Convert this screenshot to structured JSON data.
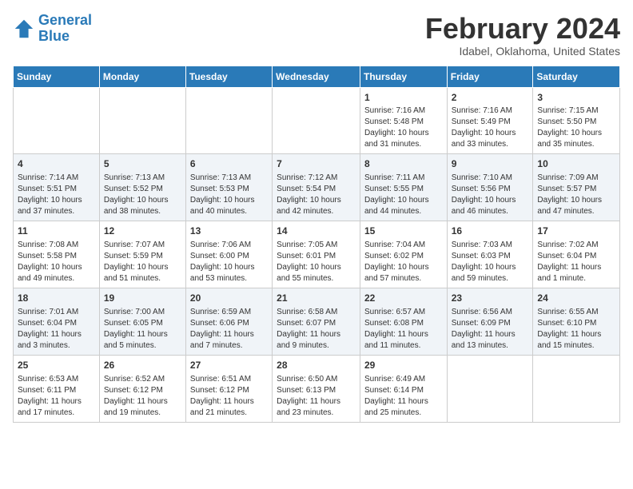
{
  "header": {
    "logo_line1": "General",
    "logo_line2": "Blue",
    "title": "February 2024",
    "subtitle": "Idabel, Oklahoma, United States"
  },
  "weekdays": [
    "Sunday",
    "Monday",
    "Tuesday",
    "Wednesday",
    "Thursday",
    "Friday",
    "Saturday"
  ],
  "weeks": [
    [
      {
        "day": "",
        "info": ""
      },
      {
        "day": "",
        "info": ""
      },
      {
        "day": "",
        "info": ""
      },
      {
        "day": "",
        "info": ""
      },
      {
        "day": "1",
        "info": "Sunrise: 7:16 AM\nSunset: 5:48 PM\nDaylight: 10 hours and 31 minutes."
      },
      {
        "day": "2",
        "info": "Sunrise: 7:16 AM\nSunset: 5:49 PM\nDaylight: 10 hours and 33 minutes."
      },
      {
        "day": "3",
        "info": "Sunrise: 7:15 AM\nSunset: 5:50 PM\nDaylight: 10 hours and 35 minutes."
      }
    ],
    [
      {
        "day": "4",
        "info": "Sunrise: 7:14 AM\nSunset: 5:51 PM\nDaylight: 10 hours and 37 minutes."
      },
      {
        "day": "5",
        "info": "Sunrise: 7:13 AM\nSunset: 5:52 PM\nDaylight: 10 hours and 38 minutes."
      },
      {
        "day": "6",
        "info": "Sunrise: 7:13 AM\nSunset: 5:53 PM\nDaylight: 10 hours and 40 minutes."
      },
      {
        "day": "7",
        "info": "Sunrise: 7:12 AM\nSunset: 5:54 PM\nDaylight: 10 hours and 42 minutes."
      },
      {
        "day": "8",
        "info": "Sunrise: 7:11 AM\nSunset: 5:55 PM\nDaylight: 10 hours and 44 minutes."
      },
      {
        "day": "9",
        "info": "Sunrise: 7:10 AM\nSunset: 5:56 PM\nDaylight: 10 hours and 46 minutes."
      },
      {
        "day": "10",
        "info": "Sunrise: 7:09 AM\nSunset: 5:57 PM\nDaylight: 10 hours and 47 minutes."
      }
    ],
    [
      {
        "day": "11",
        "info": "Sunrise: 7:08 AM\nSunset: 5:58 PM\nDaylight: 10 hours and 49 minutes."
      },
      {
        "day": "12",
        "info": "Sunrise: 7:07 AM\nSunset: 5:59 PM\nDaylight: 10 hours and 51 minutes."
      },
      {
        "day": "13",
        "info": "Sunrise: 7:06 AM\nSunset: 6:00 PM\nDaylight: 10 hours and 53 minutes."
      },
      {
        "day": "14",
        "info": "Sunrise: 7:05 AM\nSunset: 6:01 PM\nDaylight: 10 hours and 55 minutes."
      },
      {
        "day": "15",
        "info": "Sunrise: 7:04 AM\nSunset: 6:02 PM\nDaylight: 10 hours and 57 minutes."
      },
      {
        "day": "16",
        "info": "Sunrise: 7:03 AM\nSunset: 6:03 PM\nDaylight: 10 hours and 59 minutes."
      },
      {
        "day": "17",
        "info": "Sunrise: 7:02 AM\nSunset: 6:04 PM\nDaylight: 11 hours and 1 minute."
      }
    ],
    [
      {
        "day": "18",
        "info": "Sunrise: 7:01 AM\nSunset: 6:04 PM\nDaylight: 11 hours and 3 minutes."
      },
      {
        "day": "19",
        "info": "Sunrise: 7:00 AM\nSunset: 6:05 PM\nDaylight: 11 hours and 5 minutes."
      },
      {
        "day": "20",
        "info": "Sunrise: 6:59 AM\nSunset: 6:06 PM\nDaylight: 11 hours and 7 minutes."
      },
      {
        "day": "21",
        "info": "Sunrise: 6:58 AM\nSunset: 6:07 PM\nDaylight: 11 hours and 9 minutes."
      },
      {
        "day": "22",
        "info": "Sunrise: 6:57 AM\nSunset: 6:08 PM\nDaylight: 11 hours and 11 minutes."
      },
      {
        "day": "23",
        "info": "Sunrise: 6:56 AM\nSunset: 6:09 PM\nDaylight: 11 hours and 13 minutes."
      },
      {
        "day": "24",
        "info": "Sunrise: 6:55 AM\nSunset: 6:10 PM\nDaylight: 11 hours and 15 minutes."
      }
    ],
    [
      {
        "day": "25",
        "info": "Sunrise: 6:53 AM\nSunset: 6:11 PM\nDaylight: 11 hours and 17 minutes."
      },
      {
        "day": "26",
        "info": "Sunrise: 6:52 AM\nSunset: 6:12 PM\nDaylight: 11 hours and 19 minutes."
      },
      {
        "day": "27",
        "info": "Sunrise: 6:51 AM\nSunset: 6:12 PM\nDaylight: 11 hours and 21 minutes."
      },
      {
        "day": "28",
        "info": "Sunrise: 6:50 AM\nSunset: 6:13 PM\nDaylight: 11 hours and 23 minutes."
      },
      {
        "day": "29",
        "info": "Sunrise: 6:49 AM\nSunset: 6:14 PM\nDaylight: 11 hours and 25 minutes."
      },
      {
        "day": "",
        "info": ""
      },
      {
        "day": "",
        "info": ""
      }
    ]
  ]
}
